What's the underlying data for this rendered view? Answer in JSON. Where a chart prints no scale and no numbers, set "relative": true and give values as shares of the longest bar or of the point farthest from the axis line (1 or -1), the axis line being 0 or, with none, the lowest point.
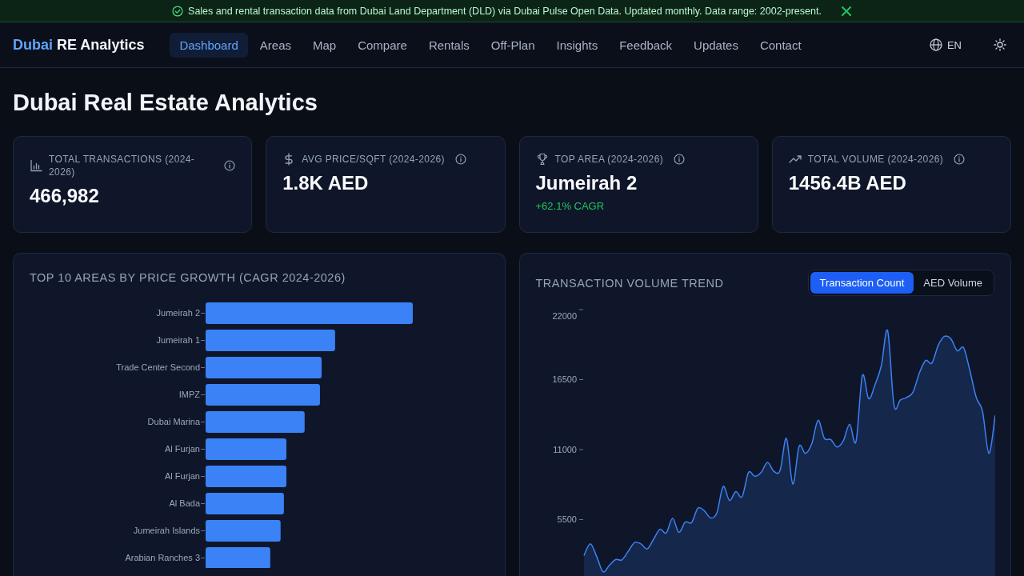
{
  "banner": {
    "text": "Sales and rental transaction data from Dubai Land Department (DLD) via Dubai Pulse Open Data. Updated monthly. Data range: 2002-present."
  },
  "nav": {
    "logo": {
      "accent": "Dubai",
      "rest": "RE Analytics"
    },
    "items": [
      {
        "label": "Dashboard",
        "selected": true
      },
      {
        "label": "Areas",
        "selected": false
      },
      {
        "label": "Map",
        "selected": false
      },
      {
        "label": "Compare",
        "selected": false
      },
      {
        "label": "Rentals",
        "selected": false
      },
      {
        "label": "Off-Plan",
        "selected": false
      },
      {
        "label": "Insights",
        "selected": false
      },
      {
        "label": "Feedback",
        "selected": false
      },
      {
        "label": "Updates",
        "selected": false
      },
      {
        "label": "Contact",
        "selected": false
      }
    ],
    "language": "EN"
  },
  "page_title": "Dubai Real Estate Analytics",
  "stats": [
    {
      "label": "TOTAL TRANSACTIONS (2024-2026)",
      "value": "466,982"
    },
    {
      "label": "AVG PRICE/SQFT (2024-2026)",
      "value": "1.8K AED"
    },
    {
      "label": "TOP AREA (2024-2026)",
      "value": "Jumeirah 2",
      "change": "+62.1% CAGR"
    },
    {
      "label": "TOTAL VOLUME (2024-2026)",
      "value": "1456.4B AED"
    }
  ],
  "growth_panel": {
    "chart_data": {
      "type": "bar",
      "orientation": "horizontal",
      "relative": true,
      "title": "TOP 10 AREAS BY PRICE GROWTH (CAGR 2024-2026)",
      "categories": [
        "Jumeirah 2",
        "Jumeirah 1",
        "Trade Center Second",
        "IMPZ",
        "Dubai Marina",
        "Al Furjan",
        "Al Furjan",
        "Al Bada",
        "Jumeirah Islands",
        "Arabian Ranches 3"
      ],
      "values": [
        1.0,
        0.625,
        0.56,
        0.552,
        0.478,
        0.39,
        0.39,
        0.378,
        0.362,
        0.312
      ]
    }
  },
  "volume_panel": {
    "title": "TRANSACTION VOLUME TREND",
    "toggle": [
      {
        "label": "Transaction Count",
        "selected": true
      },
      {
        "label": "AED Volume",
        "selected": false
      }
    ],
    "chart_data": {
      "type": "area",
      "ylim": [
        0,
        22000
      ],
      "yticks": [
        5500,
        11000,
        16500,
        22000
      ],
      "series": [
        {
          "color": "#3b82f6",
          "values": [
            2670,
            3600,
            2600,
            1400,
            1900,
            2360,
            2340,
            3020,
            3700,
            3590,
            3200,
            3960,
            4740,
            4450,
            5600,
            4500,
            5300,
            5260,
            6400,
            6200,
            5640,
            6030,
            8100,
            7000,
            7700,
            7300,
            9200,
            8900,
            9200,
            10000,
            9300,
            9360,
            11880,
            8300,
            11250,
            10700,
            11450,
            13300,
            11880,
            11800,
            11210,
            11700,
            13000,
            11630,
            16800,
            15000,
            16100,
            17600,
            20330,
            14500,
            14900,
            15100,
            15500,
            17000,
            18000,
            17800,
            19200,
            19900,
            19700,
            18760,
            19000,
            17200,
            15100,
            14000,
            10700,
            13690
          ]
        }
      ]
    }
  }
}
